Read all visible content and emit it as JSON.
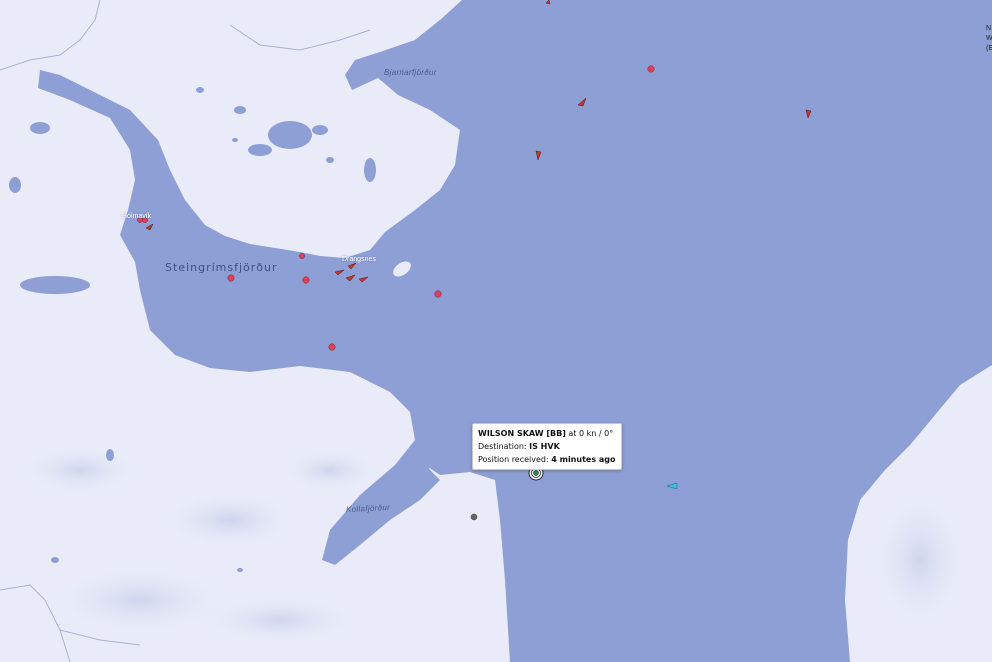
{
  "places": {
    "bjarnarfjordur": "Bjarnarfjörður",
    "steingrimsfjordur": "Steingrímsfjörður",
    "kollafjordur": "Kollafjörður",
    "holmavik": "Hólmavík",
    "drangsnes": "Drangsnes"
  },
  "vessel_tooltip": {
    "name": "WILSON SKAW [BB]",
    "speed_course": " at 0 kn / 0°",
    "destination_label": "Destination: ",
    "destination_value": "IS HVK",
    "position_label": "Position received: ",
    "position_value": "4 minutes ago"
  },
  "edge_glyphs": [
    "N",
    "W",
    "(E"
  ],
  "colors": {
    "water": "#8e9fd6",
    "land": "#e9ecf8",
    "cargo_vessel": "#c0392b",
    "passenger_vessel": "#3ec0e0",
    "anchored_marker": "#e0405a"
  }
}
